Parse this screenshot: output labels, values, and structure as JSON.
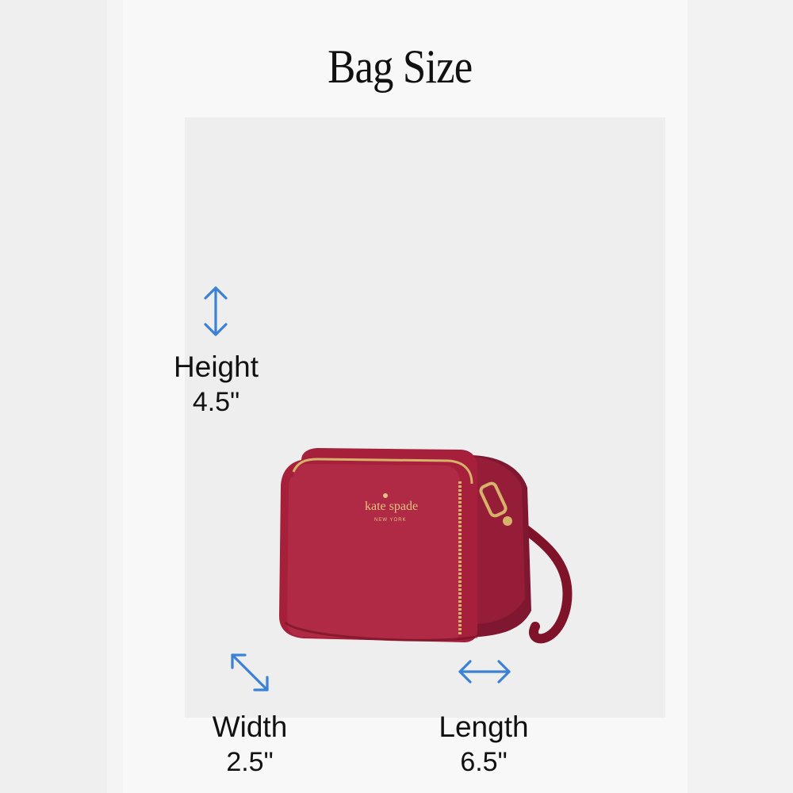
{
  "title": "Bag Size",
  "brand_logo": "kate spade new york",
  "dimensions": {
    "height": {
      "label": "Height",
      "value": "4.5\""
    },
    "width": {
      "label": "Width",
      "value": "2.5\""
    },
    "length": {
      "label": "Length",
      "value": "6.5\""
    }
  },
  "icons": {
    "height": "vertical-double-arrow-icon",
    "width": "diagonal-double-arrow-icon",
    "length": "horizontal-double-arrow-icon"
  },
  "colors": {
    "arrow": "#3b82d6",
    "bag": "#9e1c36",
    "hardware": "#d6b26a",
    "background": "#f4f4f4"
  }
}
